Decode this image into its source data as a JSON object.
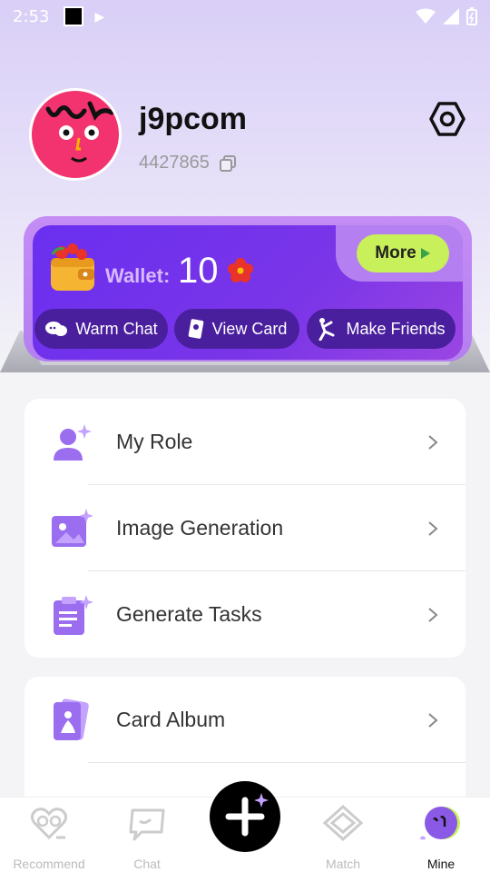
{
  "status_bar": {
    "time": "2:53"
  },
  "profile": {
    "username": "j9pcom",
    "user_id": "4427865"
  },
  "wallet": {
    "label": "Wallet:",
    "amount": "10",
    "more_label": "More",
    "actions": [
      {
        "label": "Warm Chat",
        "icon": "chat-bubbles-icon"
      },
      {
        "label": "View Card",
        "icon": "card-icon"
      },
      {
        "label": "Make Friends",
        "icon": "dancer-icon"
      }
    ]
  },
  "menu_group_1": [
    {
      "label": "My Role",
      "icon": "user-sparkle-icon"
    },
    {
      "label": "Image Generation",
      "icon": "image-sparkle-icon"
    },
    {
      "label": "Generate Tasks",
      "icon": "clipboard-sparkle-icon"
    }
  ],
  "menu_group_2": [
    {
      "label": "Card Album",
      "icon": "card-album-icon"
    }
  ],
  "bottom_nav": {
    "items": [
      {
        "label": "Recommend",
        "icon": "heart-glasses-icon"
      },
      {
        "label": "Chat",
        "icon": "chat-icon"
      },
      {
        "label": "Match",
        "icon": "diamond-icon"
      },
      {
        "label": "Mine",
        "icon": "avatar-icon"
      }
    ],
    "active": "Mine"
  },
  "colors": {
    "accent_purple": "#7a35e8",
    "more_button": "#c8f05a",
    "avatar_bg": "#f2336f",
    "icon_purple": "#9b6ef0"
  }
}
